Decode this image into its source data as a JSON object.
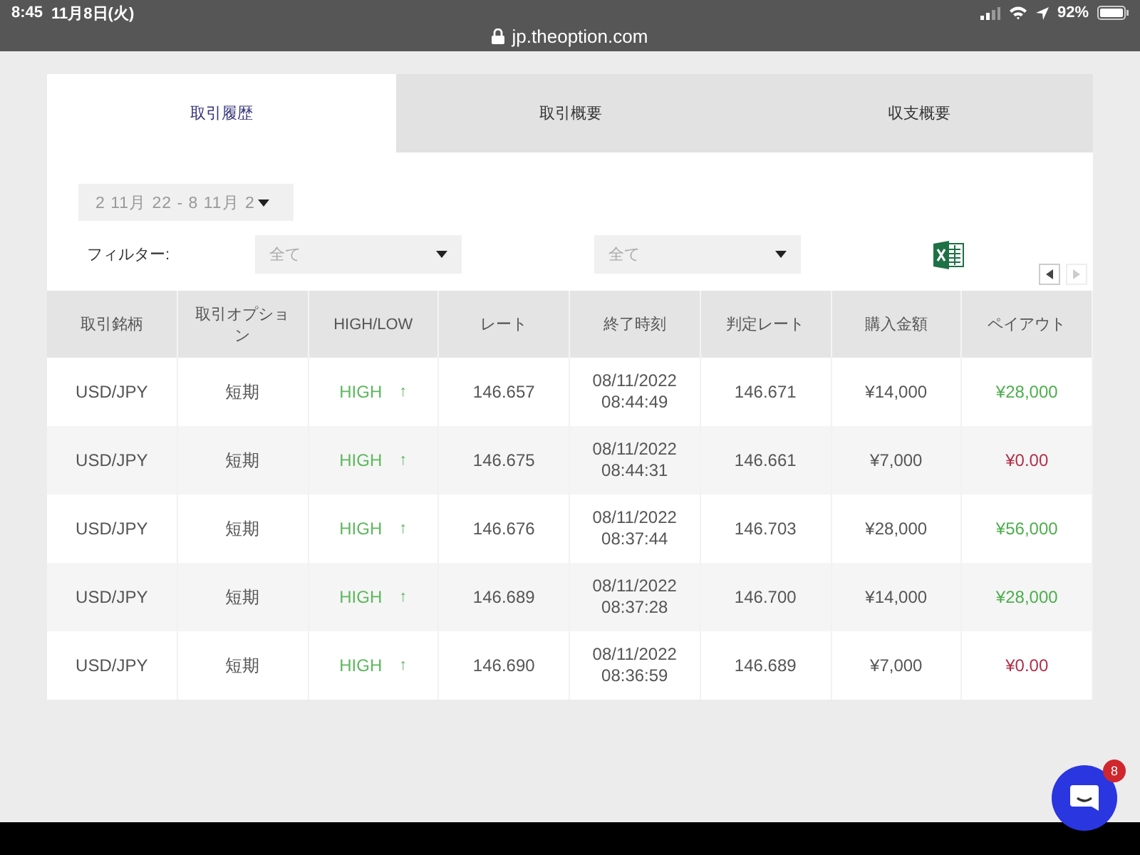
{
  "status_bar": {
    "time": "8:45",
    "date": "11月8日(火)",
    "battery": "92%",
    "url": "jp.theoption.com"
  },
  "tabs": [
    {
      "label": "取引履歴",
      "selected": true
    },
    {
      "label": "取引概要",
      "selected": false
    },
    {
      "label": "収支概要",
      "selected": false
    }
  ],
  "date_range": "2 11月 22 - 8 11月 2",
  "filter": {
    "label": "フィルター:",
    "selects": [
      "全て",
      "全て"
    ]
  },
  "table": {
    "columns": [
      "取引銘柄",
      "取引オプション",
      "HIGH/LOW",
      "レート",
      "終了時刻",
      "判定レート",
      "購入金額",
      "ペイアウト"
    ],
    "rows": [
      {
        "asset": "USD/JPY",
        "option": "短期",
        "direction": "HIGH",
        "arrow": "↑",
        "rate": "146.657",
        "end_date": "08/11/2022",
        "end_time": "08:44:49",
        "result_rate": "146.671",
        "amount": "¥14,000",
        "payout": "¥28,000",
        "color": "#4cae4c"
      },
      {
        "asset": "USD/JPY",
        "option": "短期",
        "direction": "HIGH",
        "arrow": "↑",
        "rate": "146.675",
        "end_date": "08/11/2022",
        "end_time": "08:44:31",
        "result_rate": "146.661",
        "amount": "¥7,000",
        "payout": "¥0.00",
        "color": "#b0304a"
      },
      {
        "asset": "USD/JPY",
        "option": "短期",
        "direction": "HIGH",
        "arrow": "↑",
        "rate": "146.676",
        "end_date": "08/11/2022",
        "end_time": "08:37:44",
        "result_rate": "146.703",
        "amount": "¥28,000",
        "payout": "¥56,000",
        "color": "#4cae4c"
      },
      {
        "asset": "USD/JPY",
        "option": "短期",
        "direction": "HIGH",
        "arrow": "↑",
        "rate": "146.689",
        "end_date": "08/11/2022",
        "end_time": "08:37:28",
        "result_rate": "146.700",
        "amount": "¥14,000",
        "payout": "¥28,000",
        "color": "#4cae4c"
      },
      {
        "asset": "USD/JPY",
        "option": "短期",
        "direction": "HIGH",
        "arrow": "↑",
        "rate": "146.690",
        "end_date": "08/11/2022",
        "end_time": "08:36:59",
        "result_rate": "146.689",
        "amount": "¥7,000",
        "payout": "¥0.00",
        "color": "#b0304a"
      }
    ]
  },
  "chat_badge": "8"
}
